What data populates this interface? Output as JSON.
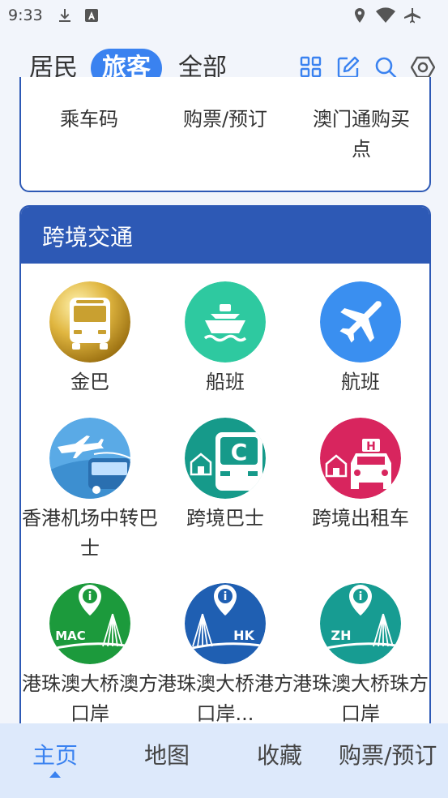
{
  "status_bar": {
    "time": "9:33",
    "icons": [
      "download-icon",
      "text-a-icon",
      "location-icon",
      "wifi-icon",
      "airplane-icon"
    ]
  },
  "header": {
    "tabs": [
      {
        "label": "居民",
        "active": false
      },
      {
        "label": "旅客",
        "active": true
      },
      {
        "label": "全部",
        "active": false
      }
    ],
    "actions": [
      "grid-icon",
      "edit-icon",
      "search-icon",
      "settings-icon"
    ],
    "accent_color": "#3a82f0"
  },
  "top_card": {
    "items": [
      {
        "label": "乘车码"
      },
      {
        "label": "购票/预订"
      },
      {
        "label": "澳门通购买点"
      }
    ]
  },
  "cross_border": {
    "title": "跨境交通",
    "header_color": "#2d59b5",
    "items": [
      {
        "label": "金巴",
        "icon": "bus-icon"
      },
      {
        "label": "船班",
        "icon": "ship-icon"
      },
      {
        "label": "航班",
        "icon": "airplane-icon"
      },
      {
        "label": "香港机场中转巴士",
        "icon": "airport-bus-icon"
      },
      {
        "label": "跨境巴士",
        "icon": "cross-border-bus-icon"
      },
      {
        "label": "跨境出租车",
        "icon": "taxi-icon"
      },
      {
        "label": "港珠澳大桥澳方口岸",
        "icon": "bridge-mac-icon",
        "badge": "MAC"
      },
      {
        "label": "港珠澳大桥港方口岸...",
        "icon": "bridge-hk-icon",
        "badge": "HK"
      },
      {
        "label": "港珠澳大桥珠方口岸",
        "icon": "bridge-zh-icon",
        "badge": "ZH"
      }
    ]
  },
  "bottom_nav": {
    "items": [
      {
        "label": "主页",
        "active": true
      },
      {
        "label": "地图",
        "active": false
      },
      {
        "label": "收藏",
        "active": false
      },
      {
        "label": "购票/预订",
        "active": false
      }
    ]
  }
}
